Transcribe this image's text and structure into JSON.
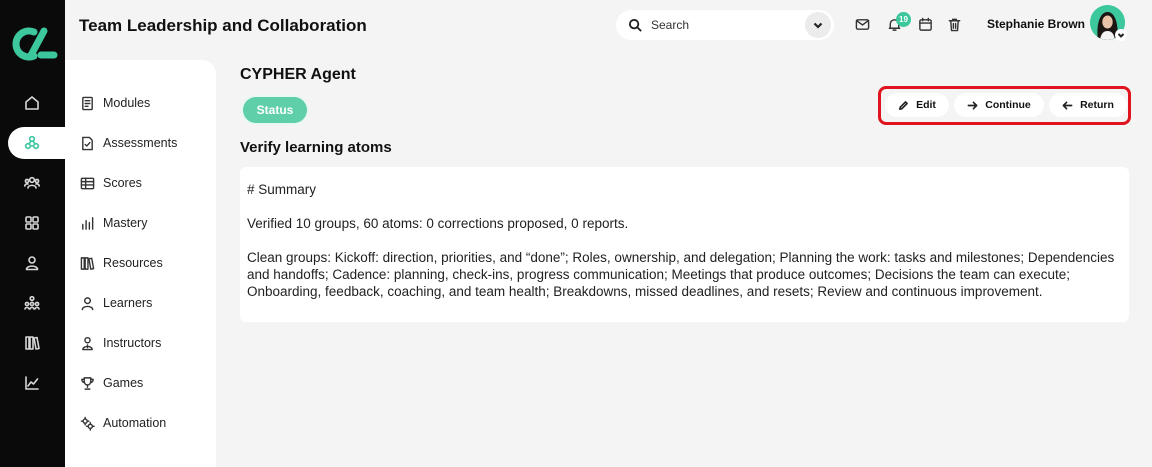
{
  "header": {
    "title": "Team Leadership and Collaboration",
    "search_placeholder": "Search",
    "notifications_count": "19",
    "user_name": "Stephanie Brown"
  },
  "rail": {
    "items": [
      "home-icon",
      "network-icon",
      "users-icon",
      "grid-icon",
      "user-icon",
      "hierarchy-icon",
      "library-icon",
      "chart-icon"
    ],
    "active": "network-icon"
  },
  "sidebar": {
    "items": [
      {
        "label": "Modules",
        "icon": "modules-icon"
      },
      {
        "label": "Assessments",
        "icon": "assessments-icon"
      },
      {
        "label": "Scores",
        "icon": "scores-icon"
      },
      {
        "label": "Mastery",
        "icon": "mastery-icon"
      },
      {
        "label": "Resources",
        "icon": "resources-icon"
      },
      {
        "label": "Learners",
        "icon": "learners-icon"
      },
      {
        "label": "Instructors",
        "icon": "instructors-icon"
      },
      {
        "label": "Games",
        "icon": "trophy-icon"
      },
      {
        "label": "Automation",
        "icon": "gears-icon"
      }
    ]
  },
  "main": {
    "agent_title": "CYPHER Agent",
    "status_label": "Status",
    "actions": {
      "edit": "Edit",
      "continue": "Continue",
      "return": "Return"
    },
    "section_title": "Verify learning atoms",
    "summary": {
      "heading": "# Summary",
      "line1": "Verified 10 groups, 60 atoms: 0 corrections proposed, 0 reports.",
      "line2": "Clean groups: Kickoff: direction, priorities, and “done”; Roles, ownership, and delegation; Planning the work: tasks and milestones; Dependencies and handoffs; Cadence: planning, check-ins, progress communication; Meetings that produce outcomes; Decisions the team can execute; Onboarding, feedback, coaching, and team health; Breakdowns, missed deadlines, and resets; Review and continuous improvement."
    }
  },
  "colors": {
    "accent": "#3cc79d",
    "highlight": "#e0141e",
    "rail": "#0a0a0a"
  }
}
